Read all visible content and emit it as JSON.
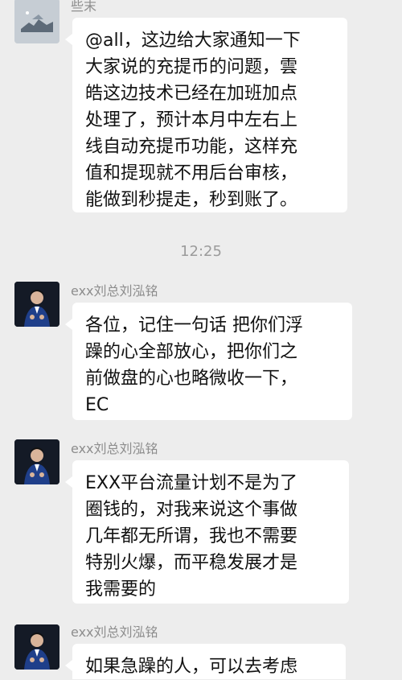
{
  "messages": [
    {
      "sender": "些末",
      "avatar": "landscape-avatar",
      "lines": [
        "@all，这边给大家通知一下",
        "大家说的充提币的问题，雲",
        "皓这边技术已经在加班加点",
        "处理了，预计本月中左右上",
        "线自动充提币功能，这样充",
        "值和提现就不用后台审核，",
        "能做到秒提走，秒到账了。"
      ]
    },
    {
      "sender": "exx刘总刘泓铭",
      "avatar": "person-avatar",
      "lines": [
        "各位，记住一句话 把你们浮",
        "躁的心全部放心，把你们之",
        "前做盘的心也略微收一下，",
        "EC"
      ]
    },
    {
      "sender": "exx刘总刘泓铭",
      "avatar": "person-avatar",
      "lines": [
        "EXX平台流量计划不是为了",
        "圈钱的，对我来说这个事做",
        "几年都无所谓，我也不需要",
        "特别火爆，而平稳发展才是",
        "我需要的"
      ]
    },
    {
      "sender": "exx刘总刘泓铭",
      "avatar": "person-avatar",
      "lines": [
        "如果急躁的人，可以去考虑"
      ]
    }
  ],
  "timestamp": "12:25",
  "colors": {
    "background": "#ededed",
    "bubble": "#ffffff",
    "name": "#8d8d8d",
    "text": "#111111"
  }
}
